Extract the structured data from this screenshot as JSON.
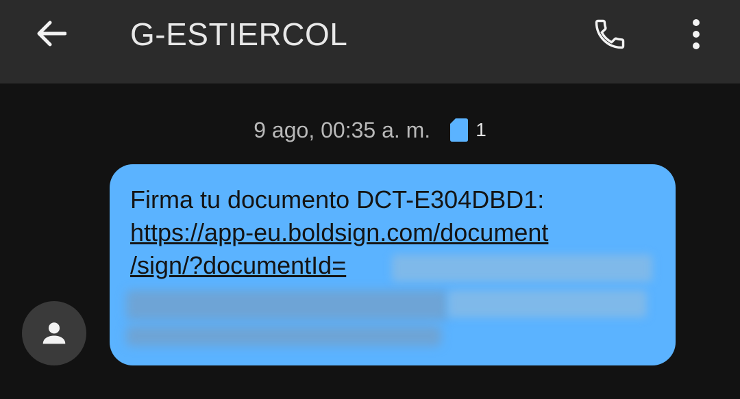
{
  "header": {
    "title": "G-ESTIERCOL",
    "back_icon": "arrow-back-icon",
    "call_icon": "phone-icon",
    "more_icon": "more-vert-icon"
  },
  "message_meta": {
    "timestamp": "9 ago, 00:35 a. m.",
    "sim_icon": "sim-card-icon",
    "sim_number": "1"
  },
  "message": {
    "text_line1": "Firma tu documento DCT-E304DBD1:",
    "link_line1": "https://app-eu.boldsign.com/document",
    "link_line2": "/sign/?documentId=",
    "redacted": true
  },
  "sender": {
    "avatar_icon": "person-icon"
  },
  "colors": {
    "appbar": "#2b2b2b",
    "background": "#121212",
    "bubble": "#5bb3ff",
    "sim_badge": "#5bb3ff"
  }
}
